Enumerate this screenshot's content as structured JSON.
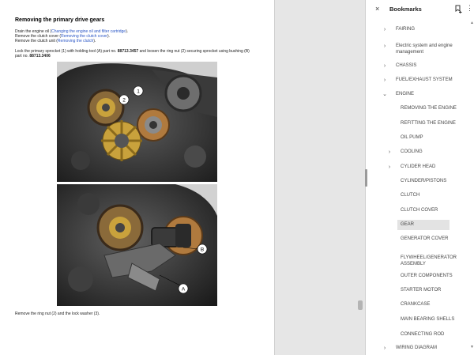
{
  "document": {
    "title": "Removing the primary drive gears",
    "steps": [
      {
        "pre": "Drain the engine oil (",
        "link": "Changing the engine oil and filter cartridge",
        "post": ")."
      },
      {
        "pre": "Remove the clutch cover (",
        "link": "Removing the clutch cover",
        "post": ")."
      },
      {
        "pre": "Remove the clutch unit (",
        "link": "Removing the clutch",
        "post": ")."
      }
    ],
    "instruction": {
      "line1_pre": "Lock the primary sprocket (1) with holding tool (A) part no. ",
      "part1": "88713.3457",
      "line1_post": " and loosen the ring nut (2) securing sprocket using bushing (B)",
      "line2_pre": "part no. ",
      "part2": "88713.3406"
    },
    "photo1_callouts": [
      "2",
      "1"
    ],
    "photo2_callouts": [
      "B",
      "A"
    ],
    "footer_text": "Remove the ring nut (2) and the lock washer (3)."
  },
  "bookmarks": {
    "title": "Bookmarks",
    "close_glyph": "×",
    "more_glyph": "⋮",
    "items": [
      {
        "label": "FAIRING",
        "label2": "",
        "level": 0,
        "chevron": "›"
      },
      {
        "label": "Electric system and engine",
        "label2": "management",
        "level": 0,
        "chevron": "›"
      },
      {
        "label": "CHASSIS",
        "label2": "",
        "level": 0,
        "chevron": "›"
      },
      {
        "label": "FUEL/EXHAUST SYSTEM",
        "label2": "",
        "level": 0,
        "chevron": "›"
      },
      {
        "label": "ENGINE",
        "label2": "",
        "level": 0,
        "chevron": "⌄"
      },
      {
        "label": "REMOVING THE ENGINE",
        "label2": "",
        "level": 1,
        "chevron": ""
      },
      {
        "label": "REFITTING THE ENGINE",
        "label2": "",
        "level": 1,
        "chevron": ""
      },
      {
        "label": "OIL PUMP",
        "label2": "",
        "level": 1,
        "chevron": ""
      },
      {
        "label": "COOLING",
        "label2": "",
        "level": 1,
        "chevron": "›"
      },
      {
        "label": "CYLIDER HEAD",
        "label2": "",
        "level": 1,
        "chevron": "›"
      },
      {
        "label": "CYLINDER/PISTONS",
        "label2": "",
        "level": 1,
        "chevron": ""
      },
      {
        "label": "CLUTCH",
        "label2": "",
        "level": 1,
        "chevron": ""
      },
      {
        "label": "CLUTCH COVER",
        "label2": "",
        "level": 1,
        "chevron": ""
      },
      {
        "label": "GEAR",
        "label2": "",
        "level": 1,
        "chevron": "",
        "selected": true
      },
      {
        "label": "GENERATOR COVER",
        "label2": "",
        "level": 1,
        "chevron": ""
      },
      {
        "label": "FLYWHEEL/GENERATOR",
        "label2": "ASSEMBLY",
        "level": 1,
        "chevron": ""
      },
      {
        "label": "OUTER COMPONENTS",
        "label2": "",
        "level": 1,
        "chevron": ""
      },
      {
        "label": "STARTER MOTOR",
        "label2": "",
        "level": 1,
        "chevron": ""
      },
      {
        "label": "CRANKCASE",
        "label2": "",
        "level": 1,
        "chevron": ""
      },
      {
        "label": "MAIN BEARING SHELLS",
        "label2": "",
        "level": 1,
        "chevron": ""
      },
      {
        "label": "CONNECTING ROD",
        "label2": "",
        "level": 1,
        "chevron": ""
      },
      {
        "label": "WIRING DIAGRAM",
        "label2": "",
        "level": 0,
        "chevron": "›"
      }
    ]
  },
  "colors": {
    "link": "#2a56c6",
    "selected_bg": "#e3e3e3",
    "panel_bg": "#e6e6e6",
    "gear_gold": "#c9a23c",
    "gear_copper": "#b07a3e"
  }
}
